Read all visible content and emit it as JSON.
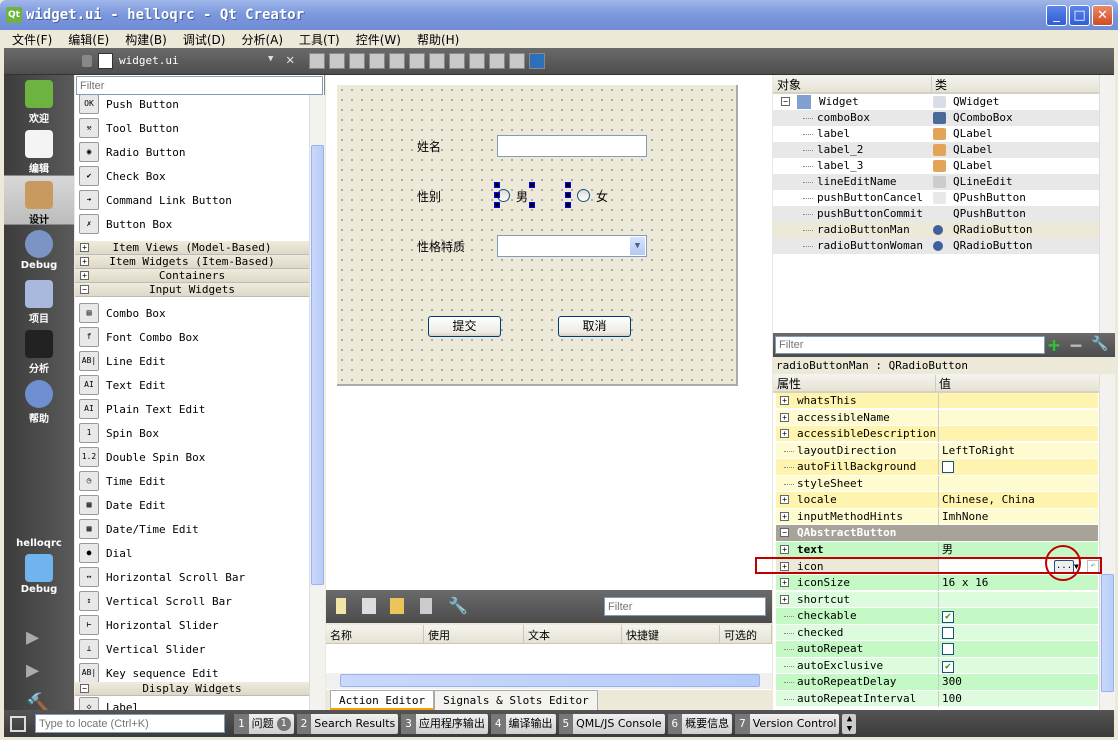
{
  "window": {
    "title": "widget.ui - helloqrc - Qt Creator",
    "controls": [
      "_",
      "□",
      "✕"
    ]
  },
  "menu": [
    "文件(F)",
    "编辑(E)",
    "构建(B)",
    "调试(D)",
    "分析(A)",
    "工具(T)",
    "控件(W)",
    "帮助(H)"
  ],
  "toolbar": {
    "document": "widget.ui",
    "close": "✕"
  },
  "modes": [
    {
      "label": "欢迎",
      "icon": "qt-logo-icon"
    },
    {
      "label": "编辑",
      "icon": "document-icon"
    },
    {
      "label": "设计",
      "icon": "design-brush-icon",
      "selected": true
    },
    {
      "label": "Debug",
      "icon": "bug-icon"
    },
    {
      "label": "项目",
      "icon": "folder-icon"
    },
    {
      "label": "分析",
      "icon": "oscilloscope-icon"
    },
    {
      "label": "帮助",
      "icon": "help-icon"
    }
  ],
  "target": {
    "project": "helloqrc",
    "config": "Debug"
  },
  "widget_box": {
    "filter_placeholder": "Filter",
    "groups": [
      {
        "type": "items",
        "items": [
          {
            "label": "Push Button",
            "icon": "OK"
          },
          {
            "label": "Tool Button",
            "icon": "⚒"
          },
          {
            "label": "Radio Button",
            "icon": "◉"
          },
          {
            "label": "Check Box",
            "icon": "✔"
          },
          {
            "label": "Command Link Button",
            "icon": "➔"
          },
          {
            "label": "Button Box",
            "icon": "✗"
          }
        ]
      },
      {
        "type": "cat",
        "label": "Item Views (Model-Based)",
        "expanded": false
      },
      {
        "type": "cat",
        "label": "Item Widgets (Item-Based)",
        "expanded": false
      },
      {
        "type": "cat",
        "label": "Containers",
        "expanded": false
      },
      {
        "type": "cat",
        "label": "Input Widgets",
        "expanded": true
      },
      {
        "type": "items",
        "items": [
          {
            "label": "Combo Box",
            "icon": "▤"
          },
          {
            "label": "Font Combo Box",
            "icon": "f"
          },
          {
            "label": "Line Edit",
            "icon": "AB|"
          },
          {
            "label": "Text Edit",
            "icon": "AI"
          },
          {
            "label": "Plain Text Edit",
            "icon": "AI"
          },
          {
            "label": "Spin Box",
            "icon": "1"
          },
          {
            "label": "Double Spin Box",
            "icon": "1.2"
          },
          {
            "label": "Time Edit",
            "icon": "◷"
          },
          {
            "label": "Date Edit",
            "icon": "▦"
          },
          {
            "label": "Date/Time Edit",
            "icon": "▦"
          },
          {
            "label": "Dial",
            "icon": "●"
          },
          {
            "label": "Horizontal Scroll Bar",
            "icon": "↔"
          },
          {
            "label": "Vertical Scroll Bar",
            "icon": "↕"
          },
          {
            "label": "Horizontal Slider",
            "icon": "⊢"
          },
          {
            "label": "Vertical Slider",
            "icon": "⊥"
          },
          {
            "label": "Key sequence Edit",
            "icon": "AB|"
          }
        ]
      },
      {
        "type": "cat",
        "label": "Display Widgets",
        "expanded": true
      },
      {
        "type": "items",
        "items": [
          {
            "label": "Label",
            "icon": "◇"
          }
        ]
      }
    ]
  },
  "form": {
    "name_label": "姓名",
    "gender_label": "性别",
    "male": "男",
    "female": "女",
    "trait_label": "性格特质",
    "submit": "提交",
    "cancel": "取消"
  },
  "action_editor": {
    "filter_placeholder": "Filter",
    "columns": [
      "名称",
      "使用",
      "文本",
      "快捷键",
      "可选的"
    ],
    "tabs": [
      "Action Editor",
      "Signals & Slots Editor"
    ]
  },
  "object_inspector": {
    "headers": [
      "对象",
      "类"
    ],
    "rows": [
      {
        "name": "Widget",
        "class": "QWidget",
        "root": true
      },
      {
        "name": "comboBox",
        "class": "QComboBox"
      },
      {
        "name": "label",
        "class": "QLabel"
      },
      {
        "name": "label_2",
        "class": "QLabel"
      },
      {
        "name": "label_3",
        "class": "QLabel"
      },
      {
        "name": "lineEditName",
        "class": "QLineEdit"
      },
      {
        "name": "pushButtonCancel",
        "class": "QPushButton"
      },
      {
        "name": "pushButtonCommit",
        "class": "QPushButton"
      },
      {
        "name": "radioButtonMan",
        "class": "QRadioButton",
        "selected": true
      },
      {
        "name": "radioButtonWoman",
        "class": "QRadioButton"
      }
    ]
  },
  "property_editor": {
    "filter_placeholder": "Filter",
    "object_class": "radioButtonMan : QRadioButton",
    "headers": [
      "属性",
      "值"
    ],
    "rows": [
      {
        "name": "whatsThis",
        "value": "",
        "exp": true,
        "grp": "w"
      },
      {
        "name": "accessibleName",
        "value": "",
        "exp": true,
        "grp": "w"
      },
      {
        "name": "accessibleDescription",
        "value": "",
        "exp": true,
        "grp": "w"
      },
      {
        "name": "layoutDirection",
        "value": "LeftToRight",
        "grp": "w"
      },
      {
        "name": "autoFillBackground",
        "check": false,
        "grp": "w"
      },
      {
        "name": "styleSheet",
        "value": "",
        "grp": "w"
      },
      {
        "name": "locale",
        "value": "Chinese, China",
        "exp": true,
        "grp": "w"
      },
      {
        "name": "inputMethodHints",
        "value": "ImhNone",
        "exp": true,
        "grp": "w"
      },
      {
        "name": "QAbstractButton",
        "section": true
      },
      {
        "name": "text",
        "value": "男",
        "exp": true,
        "grp": "b",
        "bold": true
      },
      {
        "name": "icon",
        "value": "",
        "exp": true,
        "grp": "b",
        "highlight": true
      },
      {
        "name": "iconSize",
        "value": "16 x 16",
        "exp": true,
        "grp": "b"
      },
      {
        "name": "shortcut",
        "value": "",
        "exp": true,
        "grp": "b"
      },
      {
        "name": "checkable",
        "check": true,
        "grp": "b"
      },
      {
        "name": "checked",
        "check": false,
        "grp": "b"
      },
      {
        "name": "autoRepeat",
        "check": false,
        "grp": "b"
      },
      {
        "name": "autoExclusive",
        "check": true,
        "grp": "b"
      },
      {
        "name": "autoRepeatDelay",
        "value": "300",
        "grp": "b"
      },
      {
        "name": "autoRepeatInterval",
        "value": "100",
        "grp": "b"
      }
    ],
    "icon_button": "...",
    "annotation_color": "#c00000"
  },
  "status": {
    "locate_placeholder": "Type to locate (Ctrl+K)",
    "tabs": [
      {
        "num": "1",
        "label": "问题",
        "badge": "1"
      },
      {
        "num": "2",
        "label": "Search Results"
      },
      {
        "num": "3",
        "label": "应用程序输出"
      },
      {
        "num": "4",
        "label": "编译输出"
      },
      {
        "num": "5",
        "label": "QML/JS Console"
      },
      {
        "num": "6",
        "label": "概要信息"
      },
      {
        "num": "7",
        "label": "Version Control"
      }
    ]
  },
  "colors": {
    "selection_handle": "#0000ff",
    "prop_yellow": "#fffbd0",
    "prop_green": "#c4f8c4",
    "section": "#a8a398"
  }
}
